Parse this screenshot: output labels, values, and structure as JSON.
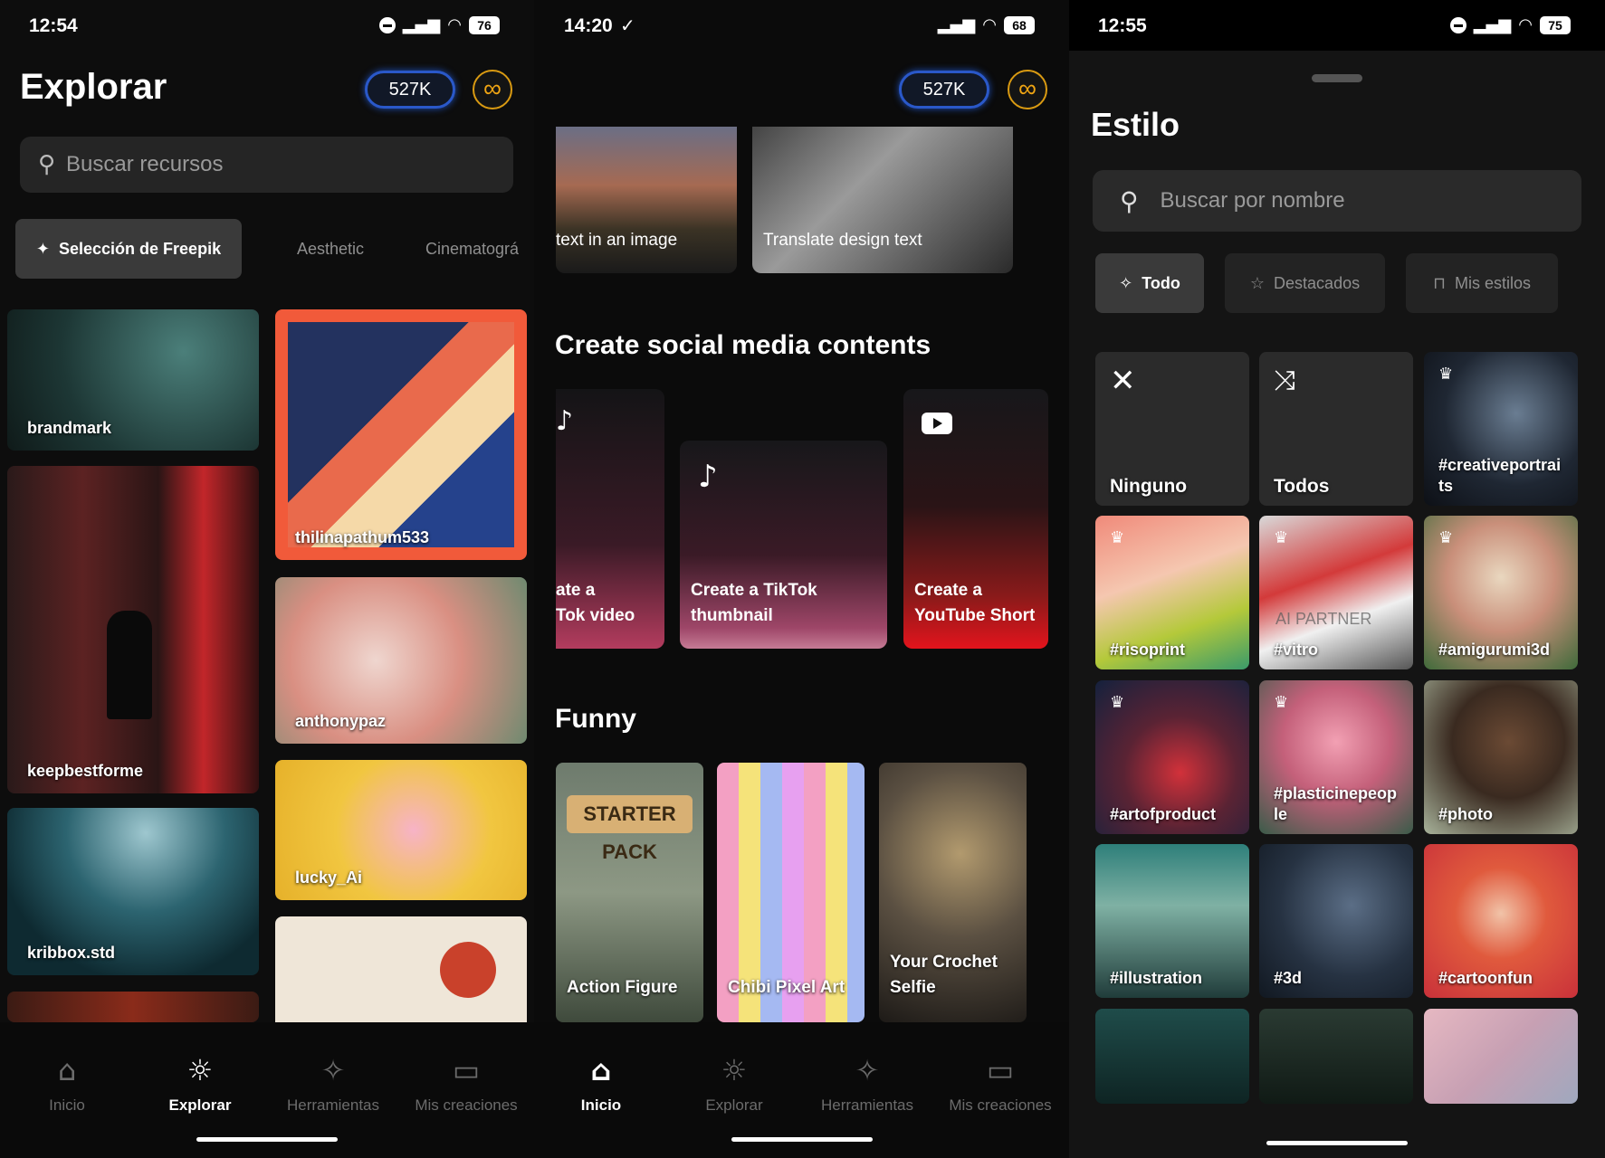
{
  "screen1": {
    "status": {
      "time": "12:54",
      "battery": "76"
    },
    "title": "Explorar",
    "credits": "527K",
    "search_placeholder": "Buscar recursos",
    "chips": [
      "Selección de Freepik",
      "Aesthetic",
      "Cinematográ"
    ],
    "cards": [
      "brandmark",
      "keepbestforme",
      "kribbox.std",
      "thilinapathum533",
      "anthonypaz",
      "lucky_Ai"
    ],
    "nav": [
      "Inicio",
      "Explorar",
      "Herramientas",
      "Mis creaciones"
    ]
  },
  "screen2": {
    "status": {
      "time": "14:20",
      "battery": "68"
    },
    "credits": "527K",
    "top_cards": [
      "text in an image",
      "Translate design text"
    ],
    "section_social": "Create social media contents",
    "social_cards": [
      {
        "line1": "ate a",
        "line2": "Tok video"
      },
      {
        "line1": "Create a TikTok",
        "line2": "thumbnail"
      },
      {
        "line1": "Create a",
        "line2": "YouTube Short"
      }
    ],
    "section_funny": "Funny",
    "funny_cards": [
      {
        "line1": "Action Figure",
        "line2": ""
      },
      {
        "line1": "Chibi Pixel Art",
        "line2": ""
      },
      {
        "line1": "Your Crochet",
        "line2": "Selfie"
      }
    ],
    "starter_pack": "STARTER PACK",
    "nav": [
      "Inicio",
      "Explorar",
      "Herramientas",
      "Mis creaciones"
    ]
  },
  "screen3": {
    "status": {
      "time": "12:55",
      "battery": "75"
    },
    "title": "Estilo",
    "search_placeholder": "Buscar por nombre",
    "tabs": [
      "Todo",
      "Destacados",
      "Mis estilos"
    ],
    "tiles": [
      {
        "line1": "Ninguno",
        "line2": ""
      },
      {
        "line1": "Todos",
        "line2": ""
      },
      {
        "line1": "#creativeportrai",
        "line2": "ts"
      },
      {
        "line1": "#risoprint",
        "line2": ""
      },
      {
        "line1": "#vitro",
        "line2": ""
      },
      {
        "line1": "#amigurumi3d",
        "line2": ""
      },
      {
        "line1": "#artofproduct",
        "line2": ""
      },
      {
        "line1": "#plasticinepeop",
        "line2": "le"
      },
      {
        "line1": "#photo",
        "line2": ""
      },
      {
        "line1": "#illustration",
        "line2": ""
      },
      {
        "line1": "#3d",
        "line2": ""
      },
      {
        "line1": "#cartoonfun",
        "line2": ""
      }
    ],
    "vitro_watermark": "AI PARTNER"
  }
}
